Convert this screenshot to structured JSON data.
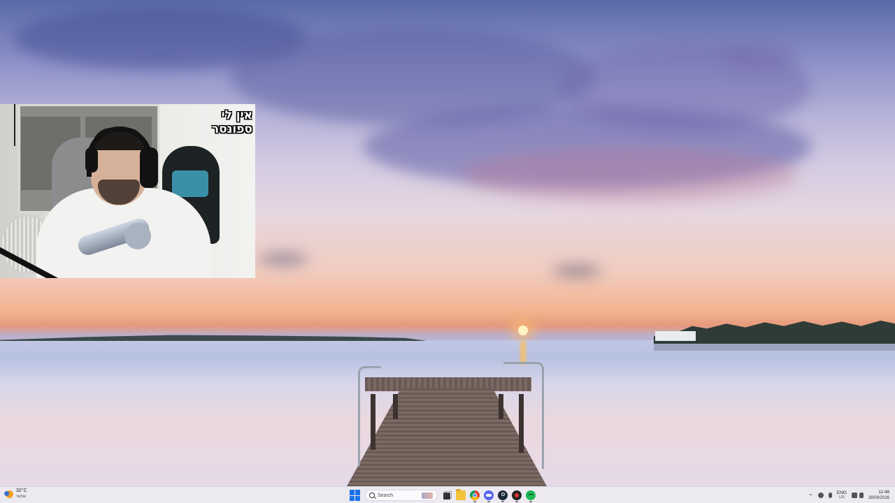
{
  "webcam": {
    "caption_line1": "אין לי",
    "caption_line2": "ספונסר"
  },
  "taskbar": {
    "weather": {
      "temp": "32°C",
      "desc": "שמשי",
      "icon": "sun-cloud-icon"
    },
    "search": {
      "placeholder": "Search"
    },
    "pinned_apps": [
      {
        "name": "start",
        "icon": "windows-start-icon"
      },
      {
        "name": "task-view",
        "icon": "task-view-icon"
      },
      {
        "name": "file-explorer",
        "icon": "folder-icon"
      },
      {
        "name": "chrome",
        "icon": "chrome-icon"
      },
      {
        "name": "discord",
        "icon": "discord-icon"
      },
      {
        "name": "steam",
        "icon": "steam-icon"
      },
      {
        "name": "app",
        "icon": "app-icon"
      },
      {
        "name": "spotify",
        "icon": "spotify-icon"
      }
    ],
    "tray": {
      "language_top": "ENG",
      "language_bottom": "US",
      "time": "11:48",
      "date": "28/08/2026"
    }
  }
}
